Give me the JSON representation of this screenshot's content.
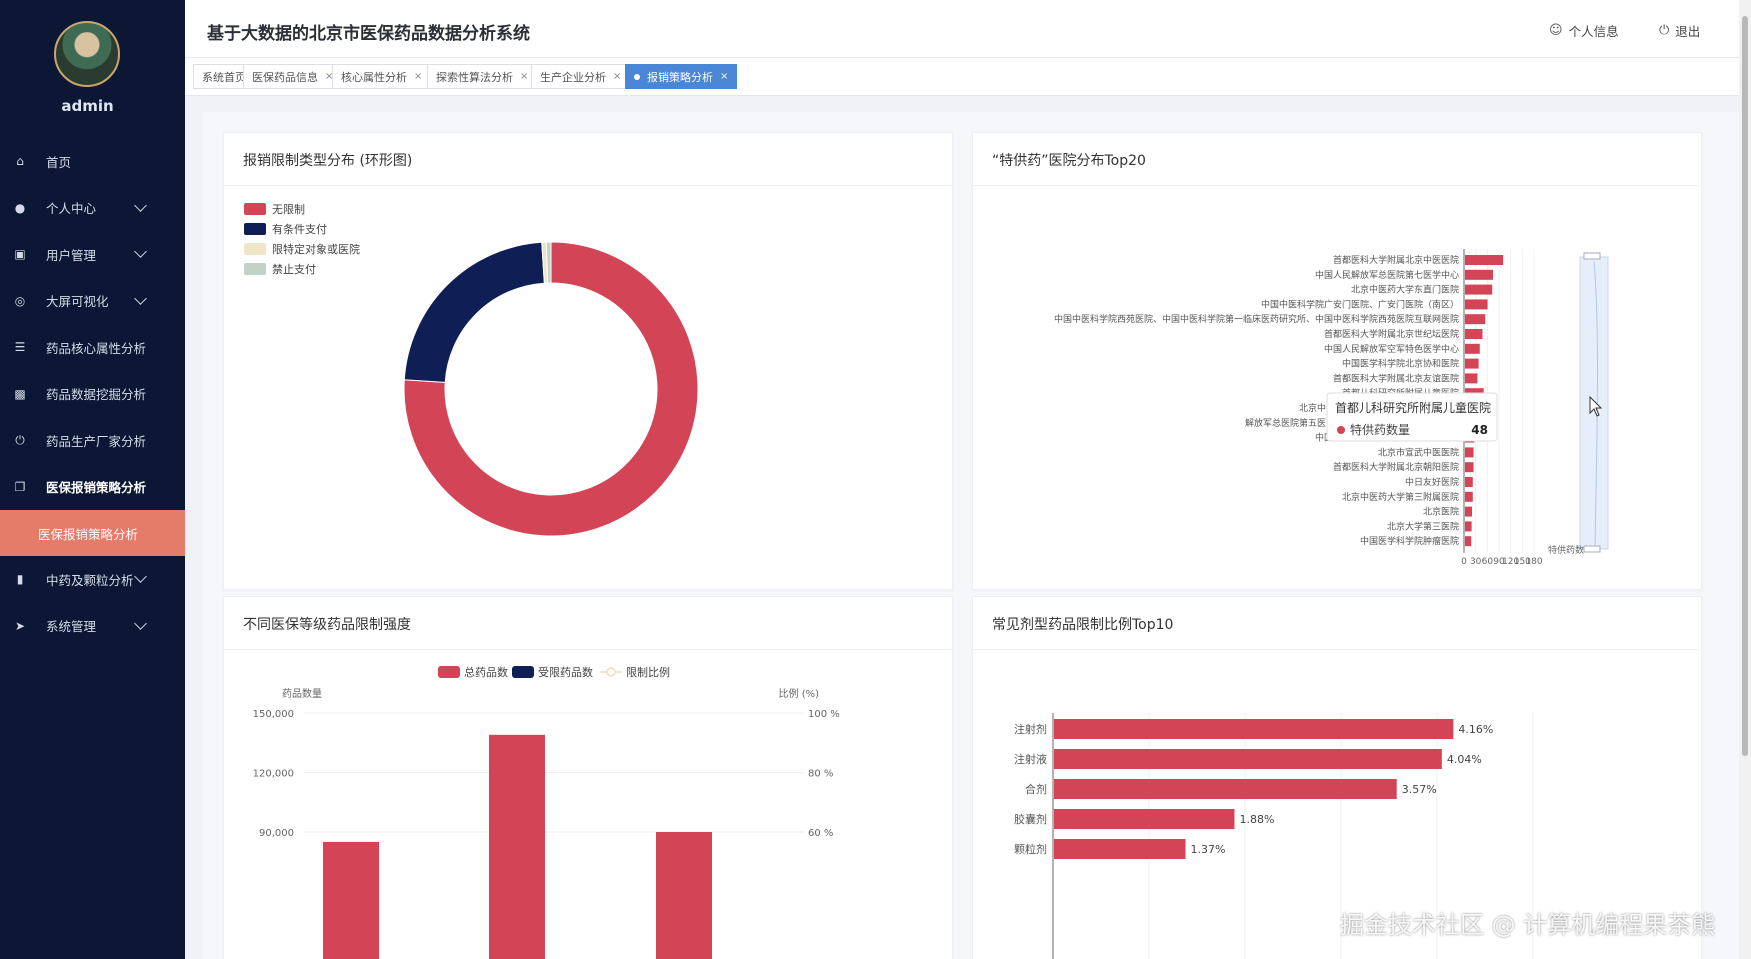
{
  "app": {
    "title": "基于大数据的北京市医保药品数据分析系统",
    "user": "admin",
    "profile_label": "个人信息",
    "logout_label": "退出"
  },
  "sidebar": {
    "items": [
      {
        "label": "首页",
        "icon": "home-icon"
      },
      {
        "label": "个人中心",
        "icon": "user-icon",
        "expandable": true
      },
      {
        "label": "用户管理",
        "icon": "clipboard-icon",
        "expandable": true
      },
      {
        "label": "大屏可视化",
        "icon": "target-icon",
        "expandable": true
      },
      {
        "label": "药品核心属性分析",
        "icon": "list-icon"
      },
      {
        "label": "药品数据挖掘分析",
        "icon": "briefcase-icon"
      },
      {
        "label": "药品生产厂家分析",
        "icon": "power-icon"
      },
      {
        "label": "医保报销策略分析",
        "icon": "copy-icon",
        "active": true
      },
      {
        "label": "中药及颗粒分析",
        "icon": "bookmark-icon",
        "expandable": true
      },
      {
        "label": "系统管理",
        "icon": "send-icon",
        "expandable": true
      }
    ],
    "active_sub": "医保报销策略分析"
  },
  "tabs": [
    {
      "label": "系统首页",
      "closable": false
    },
    {
      "label": "医保药品信息",
      "closable": true
    },
    {
      "label": "核心属性分析",
      "closable": true
    },
    {
      "label": "探索性算法分析",
      "closable": true
    },
    {
      "label": "生产企业分析",
      "closable": true
    },
    {
      "label": "报销策略分析",
      "closable": true,
      "active": true
    }
  ],
  "chart_data": [
    {
      "type": "pie",
      "title": "报销限制类型分布 (环形图)",
      "legend": [
        "无限制",
        "有条件支付",
        "限特定对象或医院",
        "禁止支付"
      ],
      "values": [
        76.0,
        23.0,
        0.5,
        0.5
      ],
      "colors": [
        "#d44457",
        "#0f1e55",
        "#efe6c8",
        "#c2d2c8"
      ]
    },
    {
      "type": "bar",
      "orientation": "horizontal",
      "title": "“特供药”医院分布Top20",
      "series_name": "特供药数量",
      "categories": [
        "首都医科大学附属北京中医医院",
        "中国人民解放军总医院第七医学中心",
        "北京中医药大学东直门医院",
        "中国中医科学院广安门医院、广安门医院（南区）",
        "中国中医科学院西苑医院、中国中医科学院第一临床医药研究所、中国中医科学院西苑医院互联网医院",
        "首都医科大学附属北京世纪坛医院",
        "中国人民解放军空军特色医学中心",
        "中国医学科学院北京协和医院",
        "首都医科大学附属北京友谊医院",
        "首都儿科研究所附属儿童医院",
        "北京中",
        "解放军总医院第五医",
        "中国人民解放军总医院第一医学中心",
        "北京市宣武中医医院",
        "首都医科大学附属北京朝阳医院",
        "中日友好医院",
        "北京中医药大学第三附属医院",
        "北京医院",
        "北京大学第三医院",
        "中国医学科学院肿瘤医院"
      ],
      "values": [
        98,
        72,
        70,
        58,
        52,
        45,
        38,
        35,
        32,
        48,
        27,
        25,
        24,
        22,
        22,
        20,
        20,
        18,
        17,
        16
      ],
      "ticks": [
        "0",
        "30",
        "60",
        "90",
        "120",
        "150",
        "180"
      ],
      "legend_label": "特供药数",
      "tooltip": {
        "title": "首都儿科研究所附属儿童医院",
        "series": "特供药数量",
        "value": "48"
      }
    },
    {
      "type": "bar",
      "title": "不同医保等级药品限制强度",
      "legend": [
        "总药品数",
        "受限药品数",
        "限制比例"
      ],
      "ylabel": "药品数量",
      "ylabel_right": "比例 (%)",
      "yticks": [
        "150,000",
        "120,000",
        "90,000"
      ],
      "yticks_right": [
        "100 %",
        "80 %",
        "60 %"
      ],
      "ylim": [
        0,
        150000
      ],
      "series": [
        {
          "name": "总药品数",
          "values": [
            85000,
            139000,
            90000
          ]
        }
      ]
    },
    {
      "type": "bar",
      "orientation": "horizontal",
      "title": "常见剂型药品限制比例Top10",
      "categories": [
        "注射剂",
        "注射液",
        "合剂",
        "胶囊剂",
        "颗粒剂"
      ],
      "values": [
        4.16,
        4.04,
        3.57,
        1.88,
        1.37
      ],
      "value_labels": [
        "4.16%",
        "4.04%",
        "3.57%",
        "1.88%",
        "1.37%"
      ],
      "xlim": [
        0,
        5
      ]
    }
  ],
  "watermark": "掘金技术社区 @ 计算机编程果茶熊"
}
